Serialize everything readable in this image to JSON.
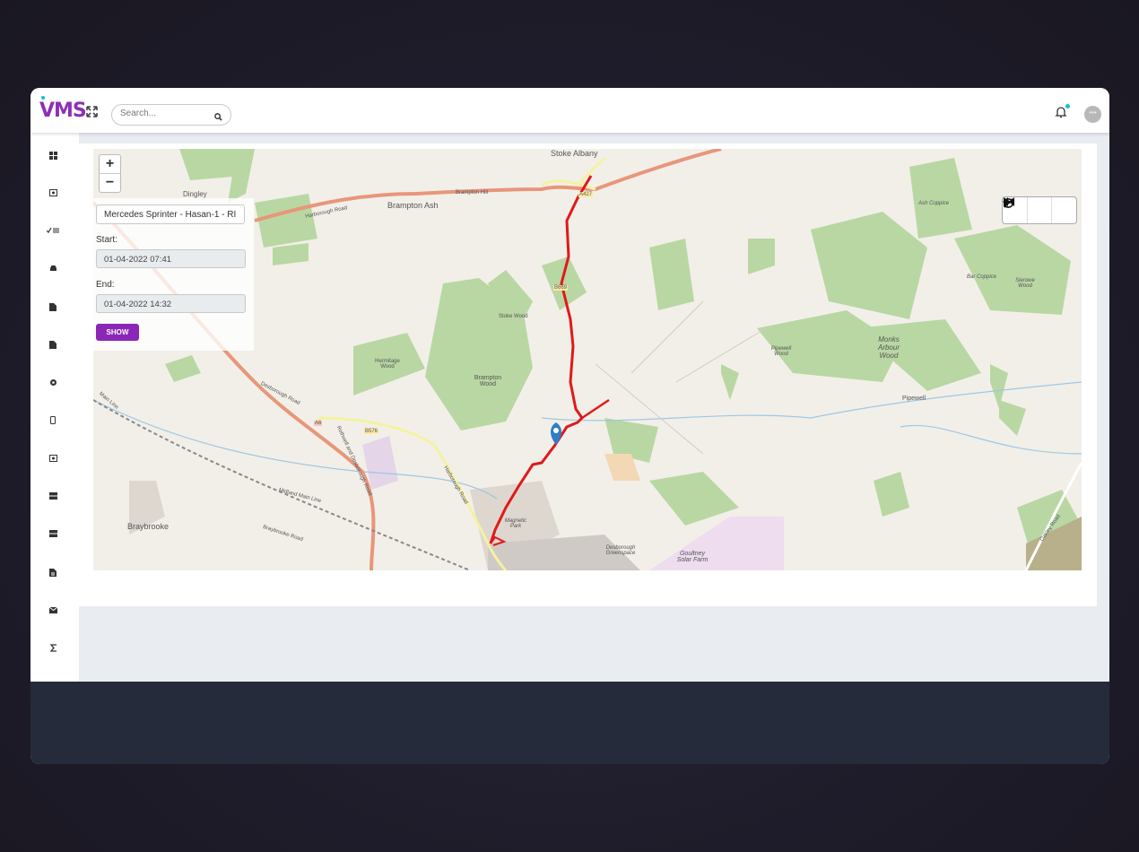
{
  "app": {
    "logo": "VMS"
  },
  "search": {
    "placeholder": "Search..."
  },
  "sidebar": {
    "items": [
      {
        "icon": "dashboard-icon"
      },
      {
        "icon": "monitor-icon"
      },
      {
        "icon": "checklist-icon"
      },
      {
        "icon": "car-icon"
      },
      {
        "icon": "document-icon"
      },
      {
        "icon": "file-icon"
      },
      {
        "icon": "gear-icon"
      },
      {
        "icon": "mobile-icon"
      },
      {
        "icon": "money-icon"
      },
      {
        "icon": "server-icon"
      },
      {
        "icon": "storage-icon"
      },
      {
        "icon": "report-icon"
      },
      {
        "icon": "mail-icon"
      },
      {
        "icon": "sigma-icon"
      }
    ]
  },
  "map": {
    "zoom_in": "+",
    "zoom_out": "−",
    "vehicle": "Mercedes Sprinter - Hasan-1 - RI",
    "start_label": "Start:",
    "start_value": "01-04-2022 07:41",
    "end_label": "End:",
    "end_value": "01-04-2022 14:32",
    "show_button": "SHOW",
    "places": {
      "stoke_albany": "Stoke Albany",
      "dingley": "Dingley",
      "brampton_ash": "Brampton Ash",
      "harborough_road": "Harborough Road",
      "brampton_hill": "Brampton Hill",
      "a427": "A427",
      "b669": "B669",
      "stoke_wood": "Stoke Wood",
      "hermitage_wood": "Hermitage Wood",
      "brampton_wood": "Brampton Wood",
      "ash_coppice": "Ash Coppice",
      "bar_coppice": "Bar Coppice",
      "sheriowe_wood": "Sierowe Wood",
      "pipewell_wood": "Pipewell Wood",
      "monks_arbour_wood": "Monks Arbour Wood",
      "pipewell": "Pipewell",
      "a6": "A6",
      "b576": "B576",
      "desborough_road": "Desborough Road",
      "rothwell_road": "Rothwell and Desborough Road",
      "harborough_road_2": "Harborough Road",
      "midland_main_line": "Midland Main Line",
      "main_line": "Main Line",
      "braybrooke": "Braybrooke",
      "braybrooke_road": "Braybrooke Road",
      "magnetic_park": "Magnetic Park",
      "desborough_greenspace": "Desborough Greenspace",
      "goultney_solar_farm": "Goultney Solar Farm",
      "oakley_road": "Oakley Road"
    }
  },
  "colors": {
    "accent": "#8b27b6",
    "route": "#e0191a",
    "footer": "#252b3b"
  }
}
